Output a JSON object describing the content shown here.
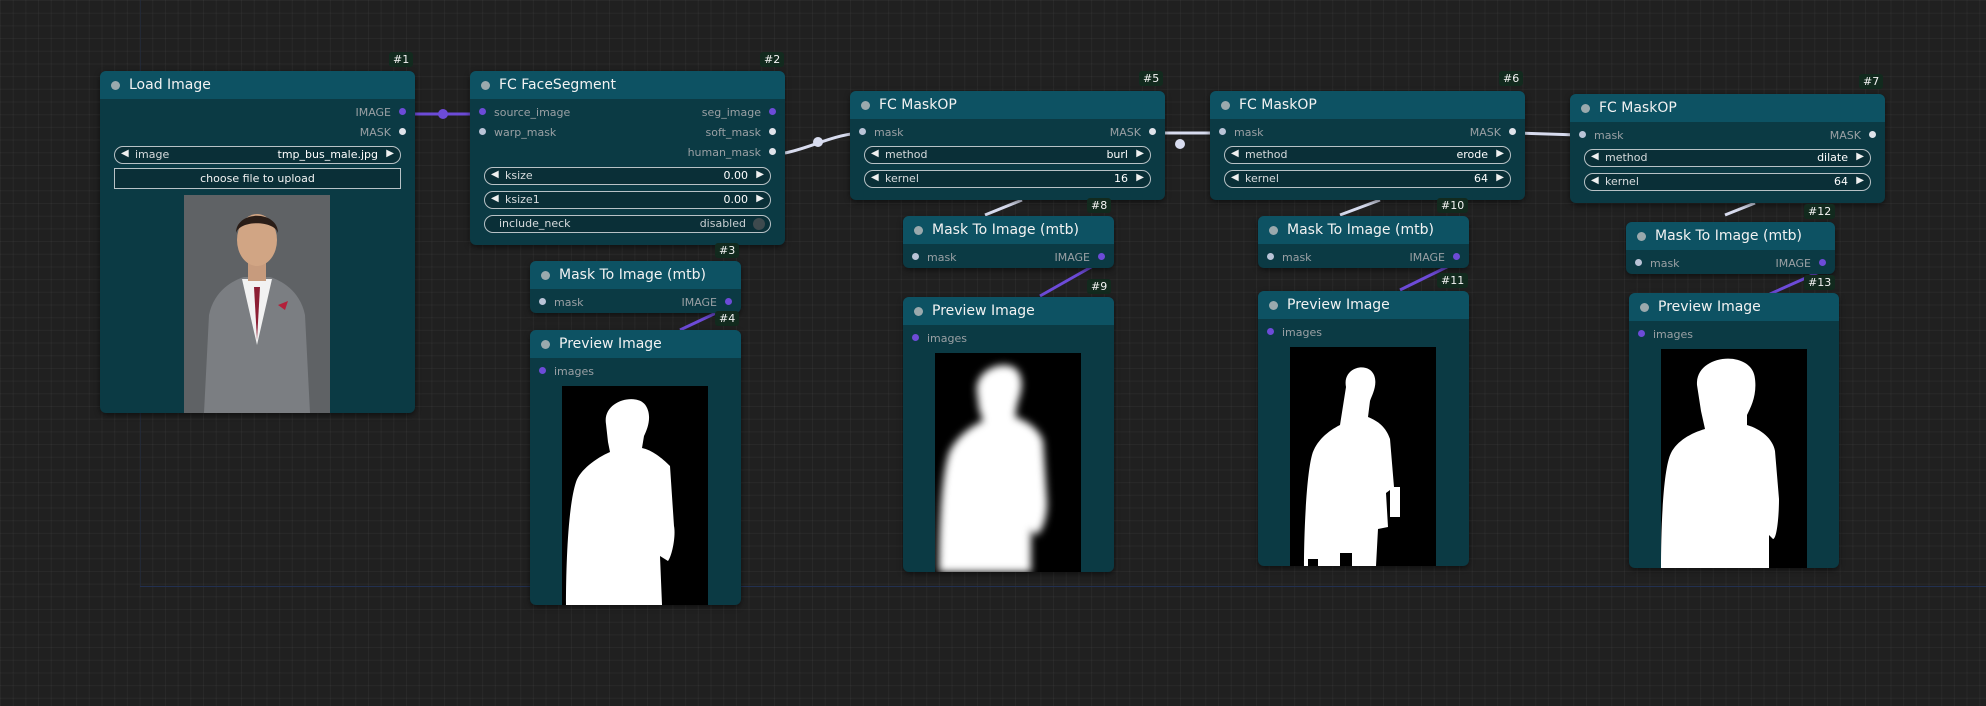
{
  "nodes": {
    "n1": {
      "title": "Load Image",
      "badge": "#1",
      "outputs": [
        "IMAGE",
        "MASK"
      ],
      "widget_image": {
        "name": "image",
        "value": "tmp_bus_male.jpg"
      },
      "upload_label": "choose file to upload"
    },
    "n2": {
      "title": "FC FaceSegment",
      "badge": "#2",
      "inputs": [
        "source_image",
        "warp_mask"
      ],
      "outputs": [
        "seg_image",
        "soft_mask",
        "human_mask"
      ],
      "ksize": {
        "name": "ksize",
        "value": "0.00"
      },
      "ksize1": {
        "name": "ksize1",
        "value": "0.00"
      },
      "include_neck": {
        "name": "include_neck",
        "value": "disabled"
      }
    },
    "n3": {
      "title": "Mask To Image (mtb)",
      "badge": "#3",
      "input": "mask",
      "output": "IMAGE"
    },
    "n4": {
      "title": "Preview Image",
      "badge": "#4",
      "input": "images"
    },
    "n5": {
      "title": "FC MaskOP",
      "badge": "#5",
      "input": "mask",
      "output": "MASK",
      "method": {
        "name": "method",
        "value": "burl"
      },
      "kernel": {
        "name": "kernel",
        "value": "16"
      }
    },
    "n6": {
      "title": "FC MaskOP",
      "badge": "#6",
      "input": "mask",
      "output": "MASK",
      "method": {
        "name": "method",
        "value": "erode"
      },
      "kernel": {
        "name": "kernel",
        "value": "64"
      }
    },
    "n7": {
      "title": "FC MaskOP",
      "badge": "#7",
      "input": "mask",
      "output": "MASK",
      "method": {
        "name": "method",
        "value": "dilate"
      },
      "kernel": {
        "name": "kernel",
        "value": "64"
      }
    },
    "n8": {
      "title": "Mask To Image (mtb)",
      "badge": "#8",
      "input": "mask",
      "output": "IMAGE"
    },
    "n9": {
      "title": "Preview Image",
      "badge": "#9",
      "input": "images"
    },
    "n10": {
      "title": "Mask To Image (mtb)",
      "badge": "#10",
      "input": "mask",
      "output": "IMAGE"
    },
    "n11": {
      "title": "Preview Image",
      "badge": "#11",
      "input": "images"
    },
    "n12": {
      "title": "Mask To Image (mtb)",
      "badge": "#12",
      "input": "mask",
      "output": "IMAGE"
    },
    "n13": {
      "title": "Preview Image",
      "badge": "#13",
      "input": "images"
    }
  },
  "colors": {
    "canvas": "#202020",
    "node_body": "#0b3a44",
    "node_header": "#0d5263",
    "image_link": "#6d4bd8",
    "mask_link": "#d8dcef",
    "badge_bg": "#122a1e"
  }
}
